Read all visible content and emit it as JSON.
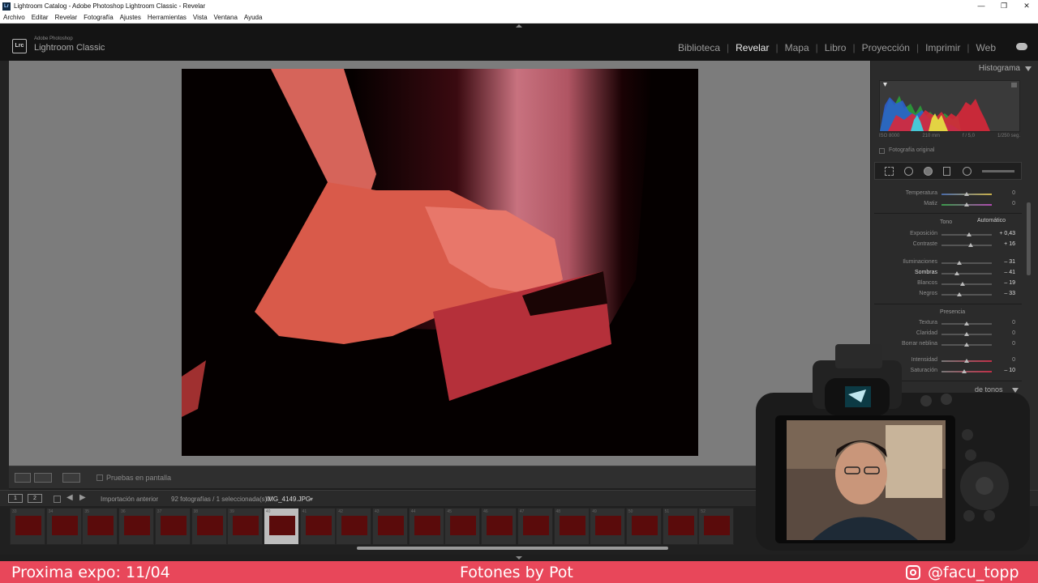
{
  "window": {
    "title": "Lightroom Catalog - Adobe Photoshop Lightroom Classic - Revelar",
    "controls": [
      "—",
      "❐",
      "✕"
    ]
  },
  "menu": [
    "Archivo",
    "Editar",
    "Revelar",
    "Fotografía",
    "Ajustes",
    "Herramientas",
    "Vista",
    "Ventana",
    "Ayuda"
  ],
  "brand": {
    "logo": "Lrc",
    "small": "Adobe Photoshop",
    "big": "Lightroom Classic"
  },
  "modules": [
    {
      "label": "Biblioteca",
      "active": false
    },
    {
      "label": "Revelar",
      "active": true
    },
    {
      "label": "Mapa",
      "active": false
    },
    {
      "label": "Libro",
      "active": false
    },
    {
      "label": "Proyección",
      "active": false
    },
    {
      "label": "Imprimir",
      "active": false
    },
    {
      "label": "Web",
      "active": false
    }
  ],
  "toolbar": {
    "proof_label": "Pruebas en pantalla"
  },
  "histogram": {
    "title": "Histograma",
    "iso": "ISO 8000",
    "focal": "210 mm",
    "aperture": "f / 5,0",
    "shutter": "1/250 seg.",
    "original_label": "Fotografía original"
  },
  "basic": {
    "wb": [
      {
        "label": "Temperatura",
        "value": "0",
        "pos": 0.5
      },
      {
        "label": "Matiz",
        "value": "0",
        "pos": 0.5
      }
    ],
    "tone_label": "Tono",
    "auto_label": "Automático",
    "tone": [
      {
        "label": "Exposición",
        "value": "+ 0,43",
        "pos": 0.55
      },
      {
        "label": "Contraste",
        "value": "+ 16",
        "pos": 0.58
      },
      {
        "label": "Iluminaciones",
        "value": "– 31",
        "pos": 0.35
      },
      {
        "label": "Sombras",
        "value": "– 41",
        "pos": 0.3,
        "highlight": true
      },
      {
        "label": "Blancos",
        "value": "– 19",
        "pos": 0.42
      },
      {
        "label": "Negros",
        "value": "– 33",
        "pos": 0.35
      }
    ],
    "presence_label": "Presencia",
    "presence": [
      {
        "label": "Textura",
        "value": "0",
        "pos": 0.5
      },
      {
        "label": "Claridad",
        "value": "0",
        "pos": 0.5
      },
      {
        "label": "Borrar neblina",
        "value": "0",
        "pos": 0.5
      },
      {
        "label": "Intensidad",
        "value": "0",
        "pos": 0.5
      },
      {
        "label": "Saturación",
        "value": "– 10",
        "pos": 0.45
      }
    ],
    "curve_label": "de tonos"
  },
  "filmbar": {
    "page1": "1",
    "page2": "2",
    "source": "Importación anterior",
    "count": "92 fotografías / 1 seleccionada(s) /",
    "file": "IMG_4149.JPG"
  },
  "filmstrip": {
    "numbers": [
      "33",
      "34",
      "35",
      "36",
      "37",
      "38",
      "39",
      "40",
      "41",
      "42",
      "43",
      "44",
      "45",
      "46",
      "47",
      "48",
      "49",
      "50",
      "51",
      "52"
    ],
    "selected": "40"
  },
  "banner": {
    "left": "Proxima expo: 11/04",
    "center": "Fotones by Pot",
    "right": "@facu_topp"
  }
}
